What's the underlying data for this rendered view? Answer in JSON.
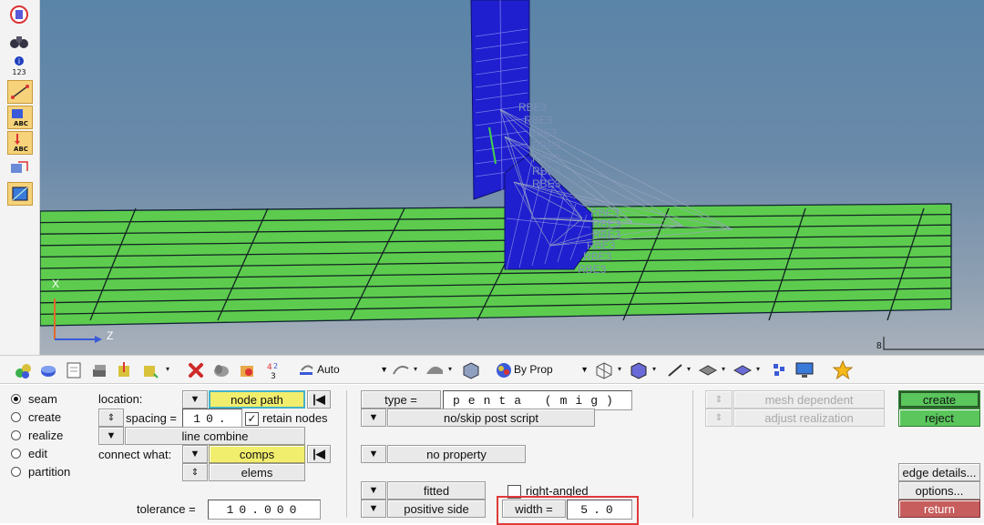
{
  "viewport": {
    "rbe_labels": [
      "RBE3",
      "RBE3",
      "RBE3",
      "RBE3",
      "RBE3",
      "RBE3",
      "RBE3",
      "RBE3",
      "RBE3",
      "RBE3",
      "RBE3",
      "RBE3",
      "RBE3"
    ],
    "axis_x": "X",
    "axis_z": "Z",
    "scale_label": "8"
  },
  "toolbar": {
    "display_mode": "Auto",
    "color_mode": "By Prop"
  },
  "panel": {
    "modes": [
      {
        "label": "seam",
        "selected": true
      },
      {
        "label": "create",
        "selected": false
      },
      {
        "label": "realize",
        "selected": false
      },
      {
        "label": "edit",
        "selected": false
      },
      {
        "label": "partition",
        "selected": false
      }
    ],
    "location_label": "location:",
    "node_path": "node path",
    "spacing_label": "spacing =",
    "spacing_value": "10.",
    "retain_nodes": "retain nodes",
    "line_combine": "line combine",
    "connect_what_label": "connect what:",
    "comps": "comps",
    "elems": "elems",
    "tolerance_label": "tolerance =",
    "tolerance_value": "10.000",
    "type_label": "type =",
    "type_value": "penta (mig)",
    "no_skip_post_script": "no/skip post script",
    "no_property": "no property",
    "fitted": "fitted",
    "right_angled": "right-angled",
    "positive_side": "positive side",
    "width_label": "width =",
    "width_value": "5.0",
    "mesh_dependent": "mesh dependent",
    "adjust_realization": "adjust realization",
    "create": "create",
    "reject": "reject",
    "edge_details": "edge details...",
    "options": "options...",
    "return": "return"
  },
  "colors": {
    "shell_green": "#5dcc4e",
    "element_blue": "#1f1fd0",
    "create_green": "#5ac65c",
    "return_red": "#c75d5d",
    "highlight_red": "#e03a3a"
  }
}
